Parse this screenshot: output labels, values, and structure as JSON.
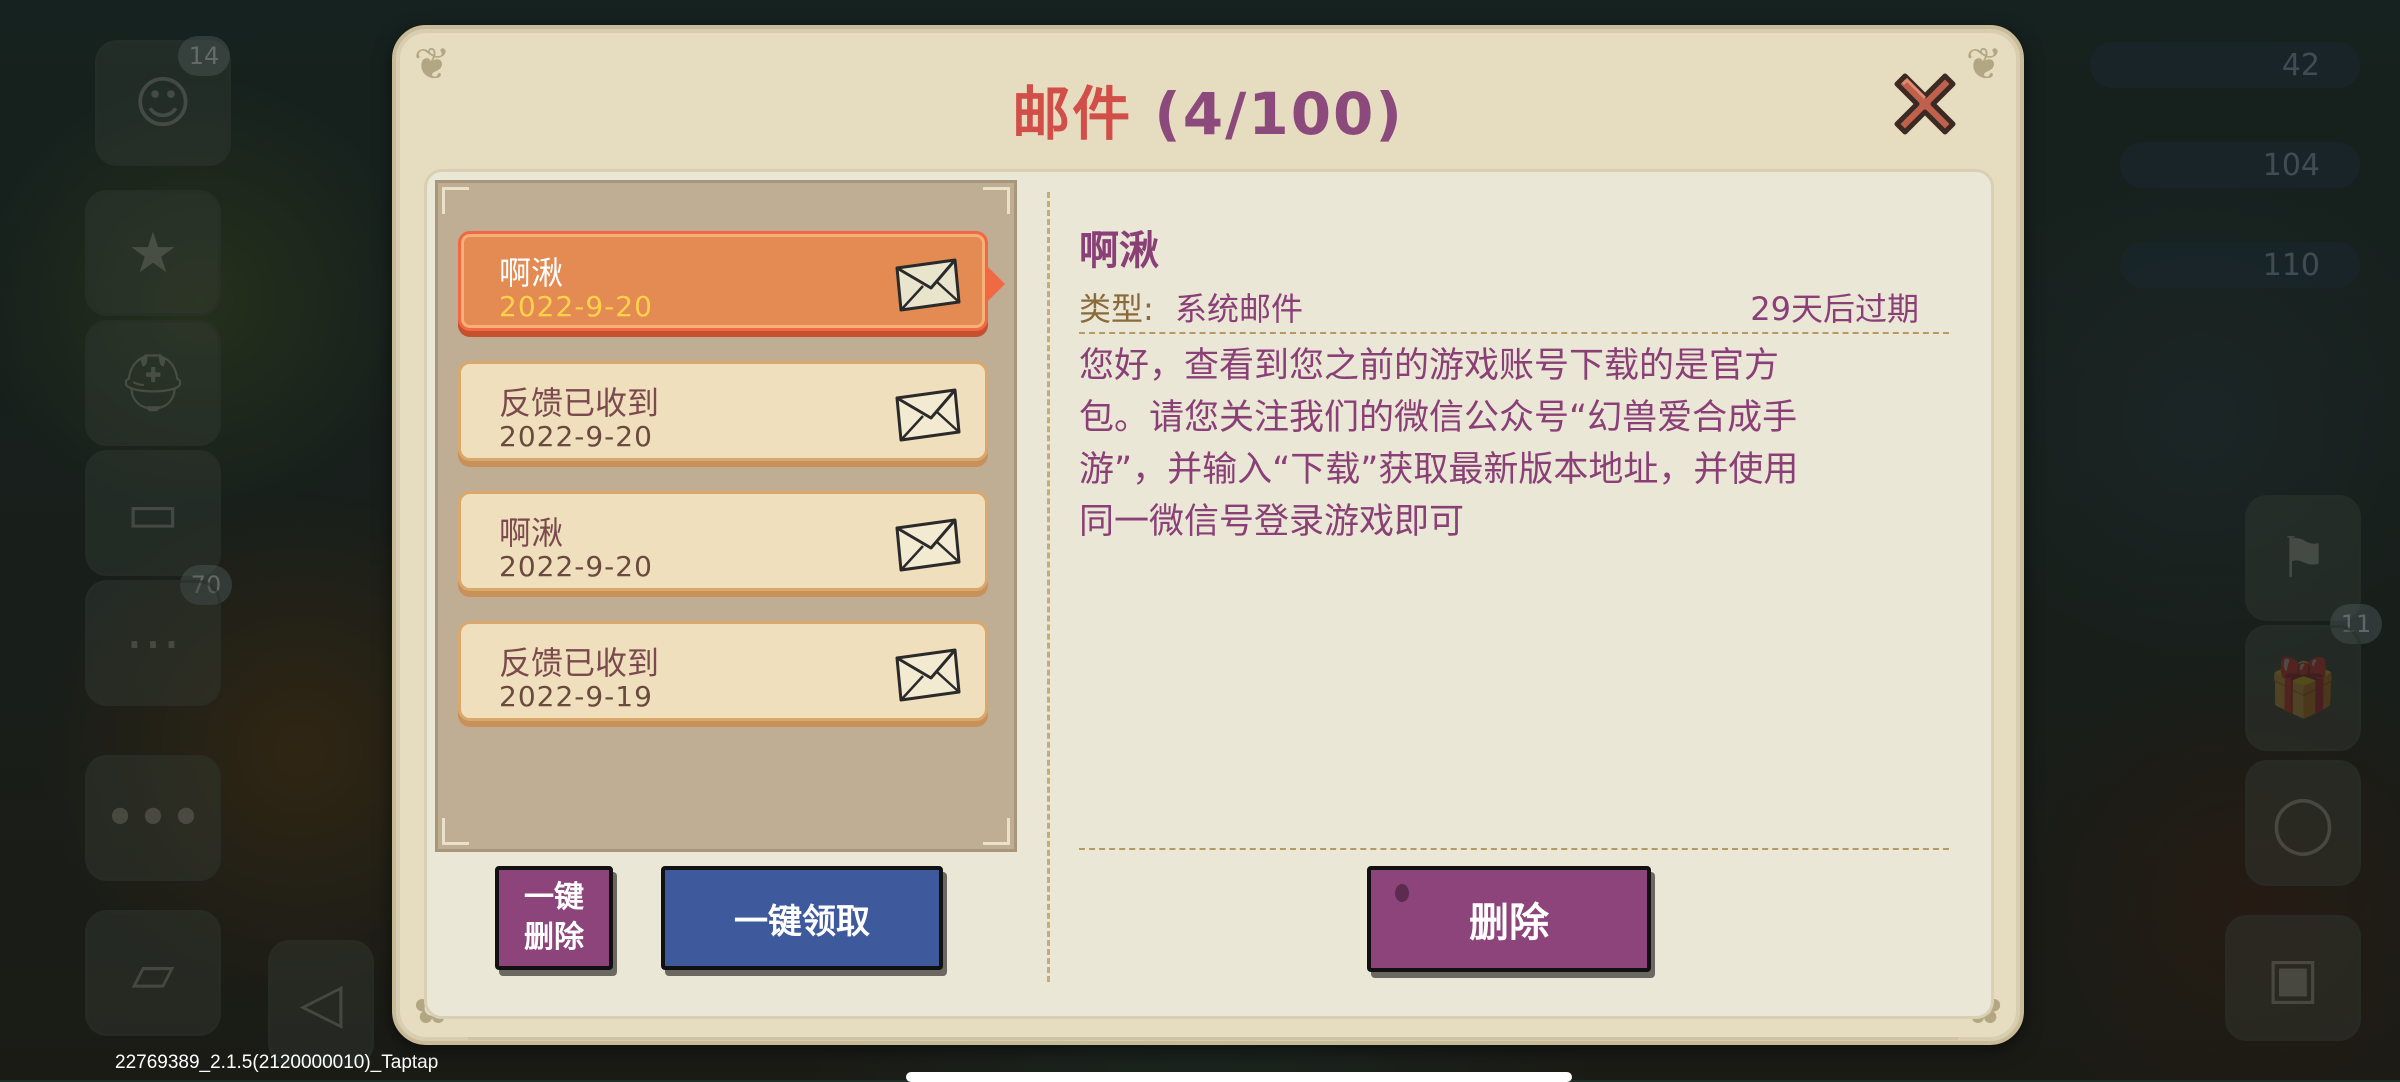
{
  "dialog": {
    "title": "邮件",
    "count": "(4/100)"
  },
  "mail_list": [
    {
      "title": "啊湫",
      "date": "2022-9-20",
      "selected": true
    },
    {
      "title": "反馈已收到",
      "date": "2022-9-20",
      "selected": false
    },
    {
      "title": "啊湫",
      "date": "2022-9-20",
      "selected": false
    },
    {
      "title": "反馈已收到",
      "date": "2022-9-19",
      "selected": false
    }
  ],
  "buttons": {
    "delete_all": "一键\n删除",
    "claim_all": "一键领取",
    "delete": "删除"
  },
  "detail": {
    "title": "啊湫",
    "type_label": "类型:",
    "type_value": "系统邮件",
    "expire": "29天后过期",
    "body": "您好，查看到您之前的游戏账号下载的是官方\n包。请您关注我们的微信公众号“幻兽爱合成手\n游”，并输入“下载”获取最新版本地址，并使用\n同一微信号登录游戏即可"
  },
  "background": {
    "badges": [
      "14",
      "70",
      "11"
    ],
    "resources": [
      "42",
      "104",
      "110"
    ],
    "build_tag": "22769389_2.1.5(2120000010)_Taptap"
  },
  "colors": {
    "title_red": "#d24e48",
    "title_purple": "#8c4a7c",
    "text_purple": "#8a3f77",
    "selected_orange": "#e38b52",
    "button_purple": "#8d447a",
    "button_blue": "#3e5a9c"
  },
  "icons": [
    "close-icon",
    "envelope-icon"
  ]
}
